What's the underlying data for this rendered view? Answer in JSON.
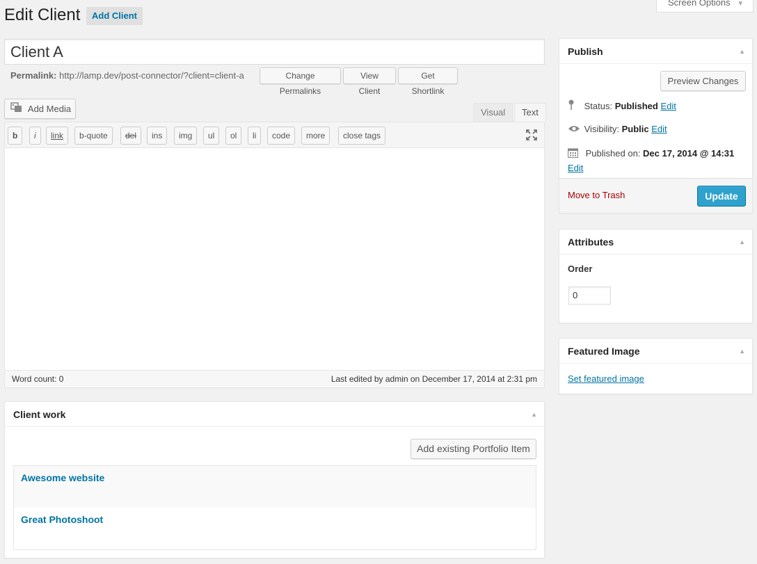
{
  "header": {
    "title": "Edit Client",
    "add_new_label": "Add Client",
    "screen_options_label": "Screen Options"
  },
  "post": {
    "title": "Client A"
  },
  "permalink": {
    "label": "Permalink:",
    "url": "http://lamp.dev/post-connector/?client=client-a",
    "change_button": "Change Permalinks",
    "view_button": "View Client",
    "shortlink_button": "Get Shortlink"
  },
  "editor": {
    "add_media_label": "Add Media",
    "tabs": [
      "Visual",
      "Text"
    ],
    "quicktags": [
      "b",
      "i",
      "link",
      "b-quote",
      "del",
      "ins",
      "img",
      "ul",
      "ol",
      "li",
      "code",
      "more",
      "close tags"
    ],
    "word_count": "Word count: 0",
    "last_edited": "Last edited by admin on December 17, 2014 at 2:31 pm"
  },
  "publish": {
    "title": "Publish",
    "preview_button": "Preview Changes",
    "status_label": "Status:",
    "status_value": "Published",
    "visibility_label": "Visibility:",
    "visibility_value": "Public",
    "published_label": "Published on:",
    "published_value": "Dec 17, 2014 @ 14:31",
    "edit_label": "Edit",
    "trash_label": "Move to Trash",
    "update_button": "Update"
  },
  "attributes": {
    "title": "Attributes",
    "order_label": "Order",
    "order_value": "0"
  },
  "featured_image": {
    "title": "Featured Image",
    "set_link": "Set featured image"
  },
  "client_work": {
    "title": "Client work",
    "add_button": "Add existing Portfolio Item",
    "items": [
      "Awesome website",
      "Great Photoshoot"
    ]
  }
}
